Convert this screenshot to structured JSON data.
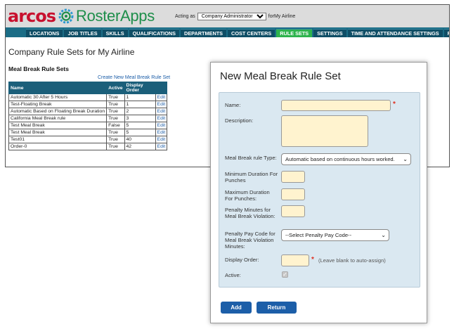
{
  "header": {
    "logo_arcos": "arcos",
    "logo_roster": "RosterApps",
    "acting_as_prefix": "Acting as",
    "acting_role": "Company Administrator",
    "acting_for": "forMy Airline",
    "brand_red": "#c8102e",
    "brand_green": "#1e8e4a"
  },
  "nav": {
    "tabs": [
      {
        "label": "LOCATIONS",
        "active": false
      },
      {
        "label": "JOB TITLES",
        "active": false
      },
      {
        "label": "SKILLS",
        "active": false
      },
      {
        "label": "QUALIFICATIONS",
        "active": false
      },
      {
        "label": "DEPARTMENTS",
        "active": false
      },
      {
        "label": "COST CENTERS",
        "active": false
      },
      {
        "label": "RULE SETS",
        "active": true
      },
      {
        "label": "SETTINGS",
        "active": false
      },
      {
        "label": "TIME AND ATTENDANCE SETTINGS",
        "active": false
      },
      {
        "label": "REPORTS",
        "active": false
      }
    ]
  },
  "main": {
    "page_title": "Company Rule Sets for My Airline",
    "section_title": "Meal Break Rule Sets",
    "create_link": "Create New Meal Break Rule Set",
    "table": {
      "headers": [
        "Name",
        "Active",
        "Display Order",
        ""
      ],
      "rows": [
        {
          "name": "Automatic 30 After 5 Hours",
          "active": "True",
          "order": "1",
          "action": "Edit"
        },
        {
          "name": "Test-Floating Break",
          "active": "True",
          "order": "1",
          "action": "Edit"
        },
        {
          "name": "Automatic Based on Floating Break Duration",
          "active": "True",
          "order": "2",
          "action": "Edit"
        },
        {
          "name": "California Meal Break rule",
          "active": "True",
          "order": "3",
          "action": "Edit"
        },
        {
          "name": "Test Meal Break",
          "active": "False",
          "order": "5",
          "action": "Edit"
        },
        {
          "name": "Test Meal Break",
          "active": "True",
          "order": "5",
          "action": "Edit"
        },
        {
          "name": "Test01",
          "active": "True",
          "order": "40",
          "action": "Edit"
        },
        {
          "name": "Order-0",
          "active": "True",
          "order": "42",
          "action": "Edit"
        }
      ]
    }
  },
  "dialog": {
    "title": "New Meal Break Rule Set",
    "labels": {
      "name": "Name:",
      "description": "Description:",
      "rule_type": "Meal Break rule Type:",
      "min_duration": "Minimum Duration For Punches",
      "max_duration": "Maximum Duration For Punches:",
      "penalty_minutes": "Penalty Minutes for Meal Break Violation:",
      "penalty_code": "Penalty Pay Code for Meal Break Violation Minutes:",
      "display_order": "Display Order:",
      "active": "Active:"
    },
    "values": {
      "name": "",
      "description": "",
      "rule_type": "Automatic based on continuous hours worked.",
      "min_duration": "",
      "max_duration": "",
      "penalty_minutes": "",
      "penalty_code": "--Select Penalty Pay Code--",
      "display_order": ""
    },
    "required_mark": "*",
    "display_order_hint": "(Leave blank to auto-assign)",
    "active_checked": true,
    "buttons": {
      "add": "Add",
      "return": "Return"
    }
  }
}
